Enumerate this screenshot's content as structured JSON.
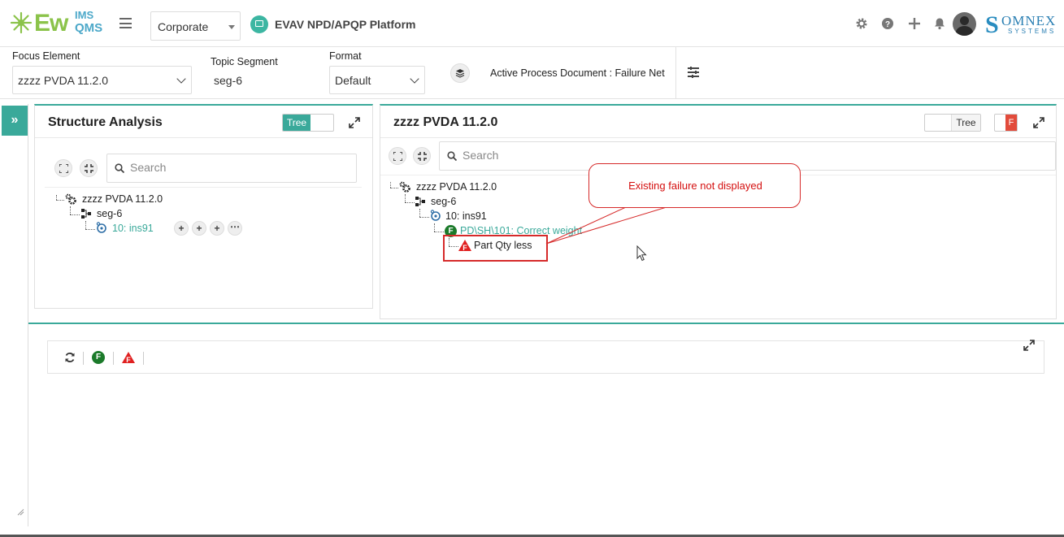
{
  "header": {
    "logo": {
      "ims": "IMS",
      "ew": "Ew",
      "qms": "QMS"
    },
    "company_select": "Corporate",
    "platform_title": "EVAV NPD/APQP Platform",
    "brand": {
      "name": "OMNEX",
      "sub": "SYSTEMS"
    }
  },
  "filters": {
    "focus_element_label": "Focus Element",
    "focus_element_value": "zzzz PVDA 11.2.0",
    "topic_segment_label": "Topic Segment",
    "topic_segment_value": "seg-6",
    "format_label": "Format",
    "format_value": "Default",
    "active_doc": "Active Process Document : Failure Net"
  },
  "structure_panel": {
    "title": "Structure Analysis",
    "toggle_label": "Tree",
    "search_placeholder": "Search",
    "tree": {
      "root": "zzzz PVDA 11.2.0",
      "segment": "seg-6",
      "process": "10: ins91"
    }
  },
  "failure_panel": {
    "title": "zzzz PVDA 11.2.0",
    "toggle_label": "Tree",
    "f_badge": "F",
    "search_placeholder": "Search",
    "tree": {
      "root": "zzzz PVDA 11.2.0",
      "segment": "seg-6",
      "process": "10: ins91",
      "function": "PD\\SH\\101: Correct weight",
      "failure": "Part Qty less"
    }
  },
  "annotation": {
    "callout": "Existing failure not displayed"
  },
  "bottom_toolbar": {
    "function_badge": "F",
    "failure_badge": "F"
  },
  "colors": {
    "accent": "#3aa99a",
    "annotation_red": "#d62a2a",
    "function_green": "#1b7a2a",
    "failure_red": "#e02020"
  }
}
